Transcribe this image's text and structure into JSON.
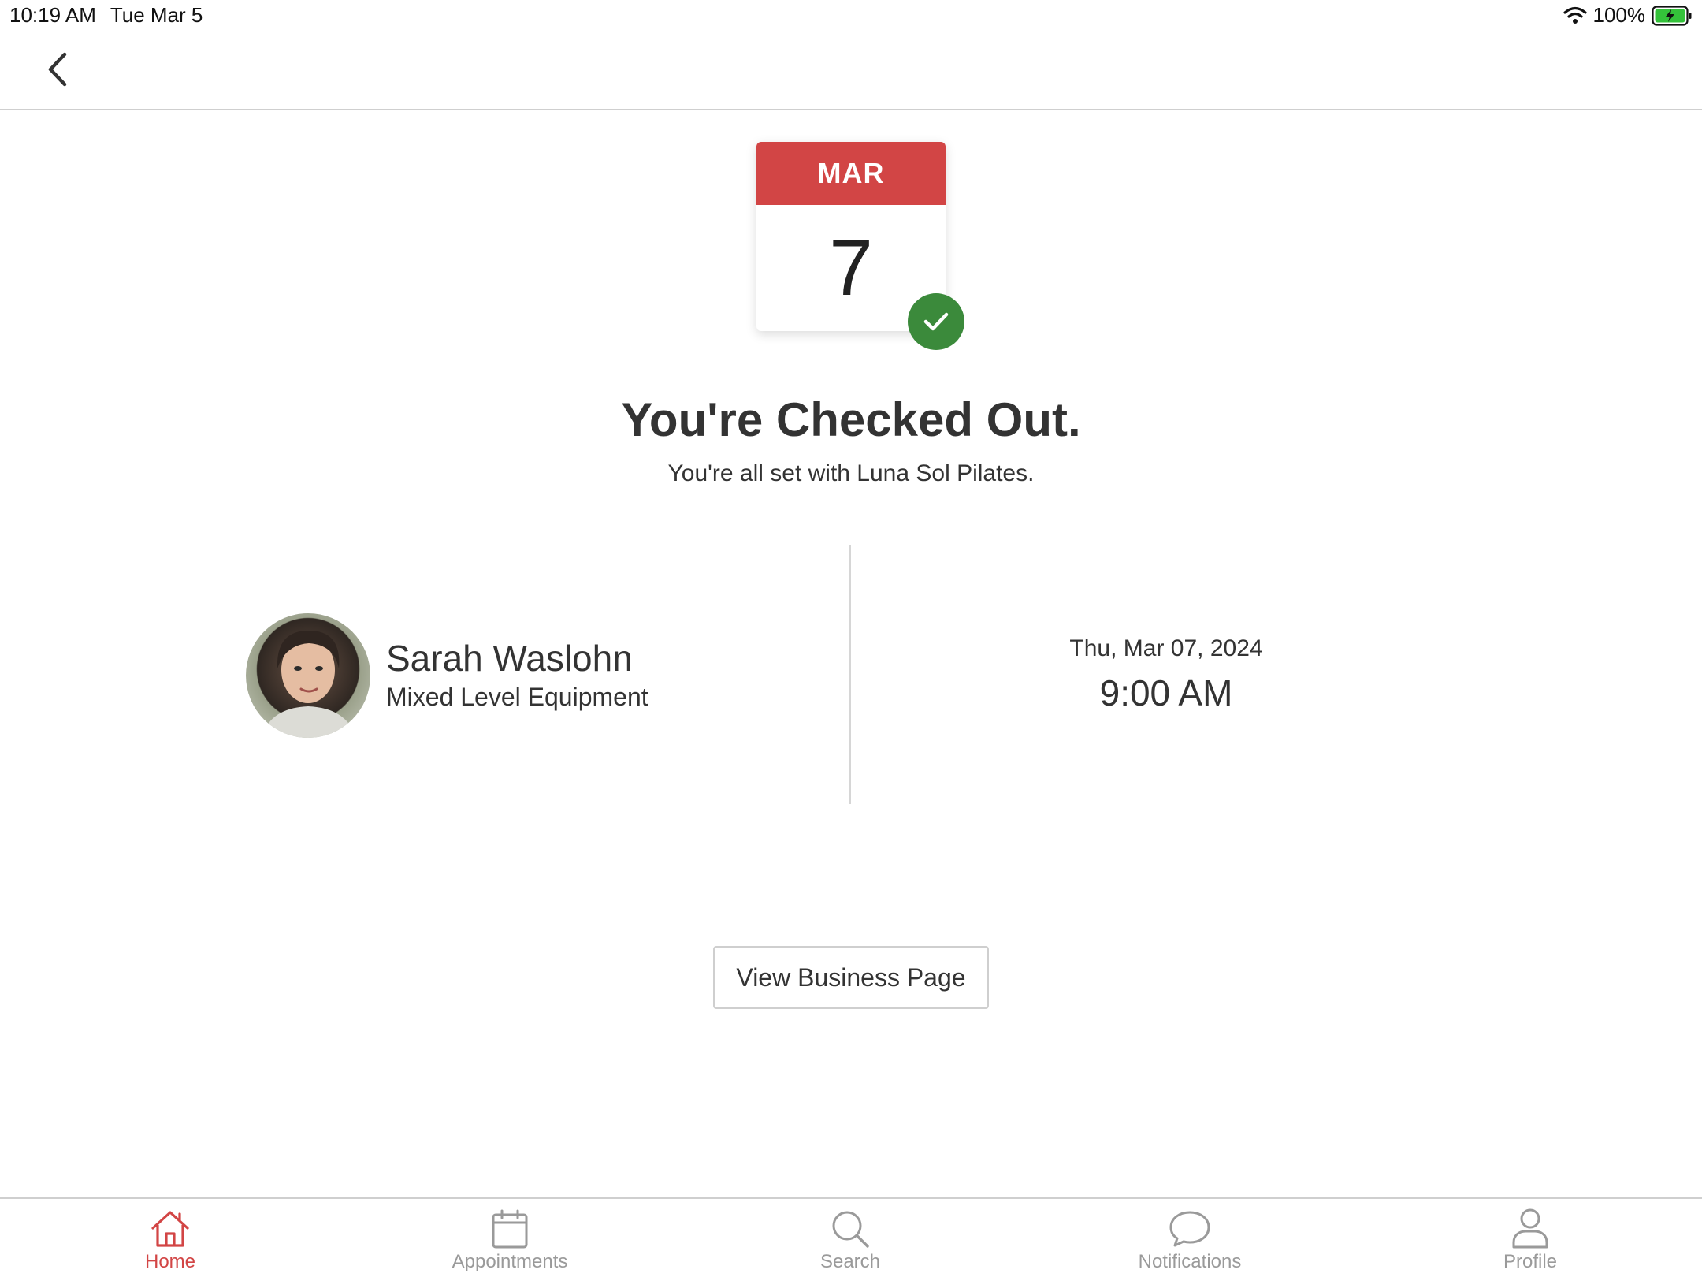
{
  "status_bar": {
    "time": "10:19 AM",
    "date": "Tue Mar 5",
    "battery": "100%"
  },
  "navbar": {
    "back_icon": "chevron-left-icon"
  },
  "calendar": {
    "month": "MAR",
    "day": "7",
    "badge_icon": "checkmark-icon",
    "badge_color": "#3b8a3b",
    "header_color": "#d24545"
  },
  "confirmation": {
    "title": "You're Checked Out.",
    "subtitle": "You're all set with Luna Sol Pilates."
  },
  "appointment": {
    "instructor": "Sarah Waslohn",
    "class_name": "Mixed Level Equipment",
    "date": "Thu, Mar 07, 2024",
    "time": "9:00 AM"
  },
  "actions": {
    "view_business_label": "View Business Page"
  },
  "tabs": [
    {
      "label": "Home",
      "icon": "home-icon",
      "active": true
    },
    {
      "label": "Appointments",
      "icon": "calendar-icon",
      "active": false
    },
    {
      "label": "Search",
      "icon": "search-icon",
      "active": false
    },
    {
      "label": "Notifications",
      "icon": "chat-bubble-icon",
      "active": false
    },
    {
      "label": "Profile",
      "icon": "person-icon",
      "active": false
    }
  ],
  "colors": {
    "accent": "#d24545",
    "inactive": "#9a9a9a"
  }
}
